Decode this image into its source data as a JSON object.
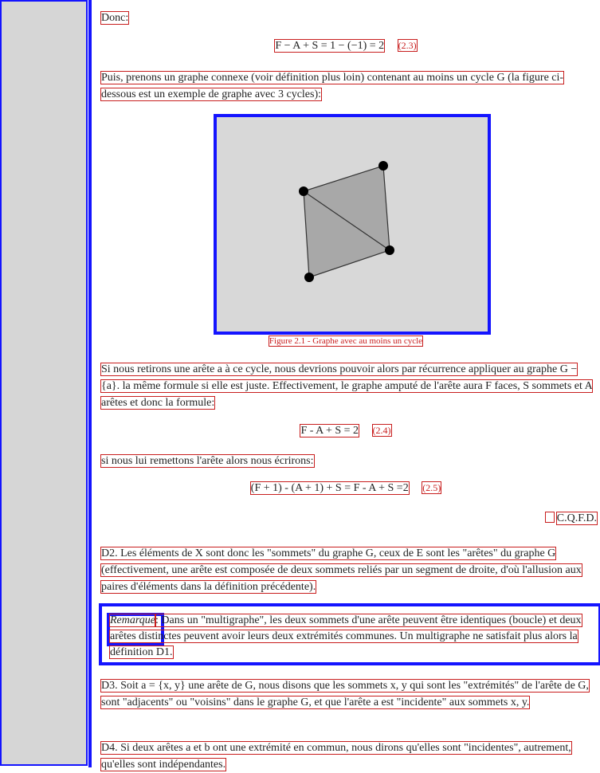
{
  "paragraphs": {
    "donc": "Donc:",
    "eq1": "F − A + S = 1 − (−1) = 2",
    "eq1_num": "(2.3)",
    "puis": "Puis, prenons un graphe connexe (voir définition plus loin) contenant au moins un cycle G (la figure ci-dessous est un exemple de graphe avec 3 cycles):",
    "caption": "Figure 2.1 - Graphe avec au moins un cycle",
    "si": "Si nous retirons une arête a à ce cycle, nous devrions pouvoir alors par récurrence appliquer au graphe G − {a}. la même formule si elle est juste. Effectivement, le graphe amputé de l'arête aura F faces, S sommets et A arêtes et donc la formule:",
    "eq2": "F - A + S = 2",
    "eq2_num": "(2.4)",
    "remettons": "si nous lui remettons l'arête alors nous écrirons:",
    "eq3": "(F + 1) - (A + 1) + S = F - A + S =2",
    "eq3_num": "(2.5)",
    "qed": "C.Q.F.D.",
    "d2": "D2. Les éléments de X sont donc les \"sommets\" du graphe G, ceux de E sont les \"arêtes\" du graphe G (effectivement, une arête est composée de deux sommets reliés par un segment de droite, d'où l'allusion aux paires d'éléments dans la définition précédente).",
    "remark_label": "Remarque",
    "remark_text": ": Dans un \"multigraphe\", les deux sommets d'une arête peuvent être identiques (boucle) et deux arêtes distinctes peuvent avoir leurs deux extrémités communes. Un multigraphe ne satisfait plus alors la définition D1.",
    "d3": "D3. Soit a = {x, y} une arête de G, nous disons que les sommets x, y qui sont les \"extrémités\" de l'arête de G, sont \"adjacents\" ou \"voisins\" dans le graphe G, et que l'arête a est \"incidente\" aux sommets x, y.",
    "d4": "D4. Si deux arêtes a et b ont une extrémité en commun, nous dirons qu'elles sont \"incidentes\", autrement, qu'elles sont indépendantes."
  },
  "figure": {
    "background": "#d8d8d8",
    "polygon_fill": "#a8a8a8",
    "vertex_color": "#000000"
  },
  "colors": {
    "accent": "#1414ff",
    "text_red": "#c81e1e",
    "sidebar": "#d6d6d6"
  }
}
